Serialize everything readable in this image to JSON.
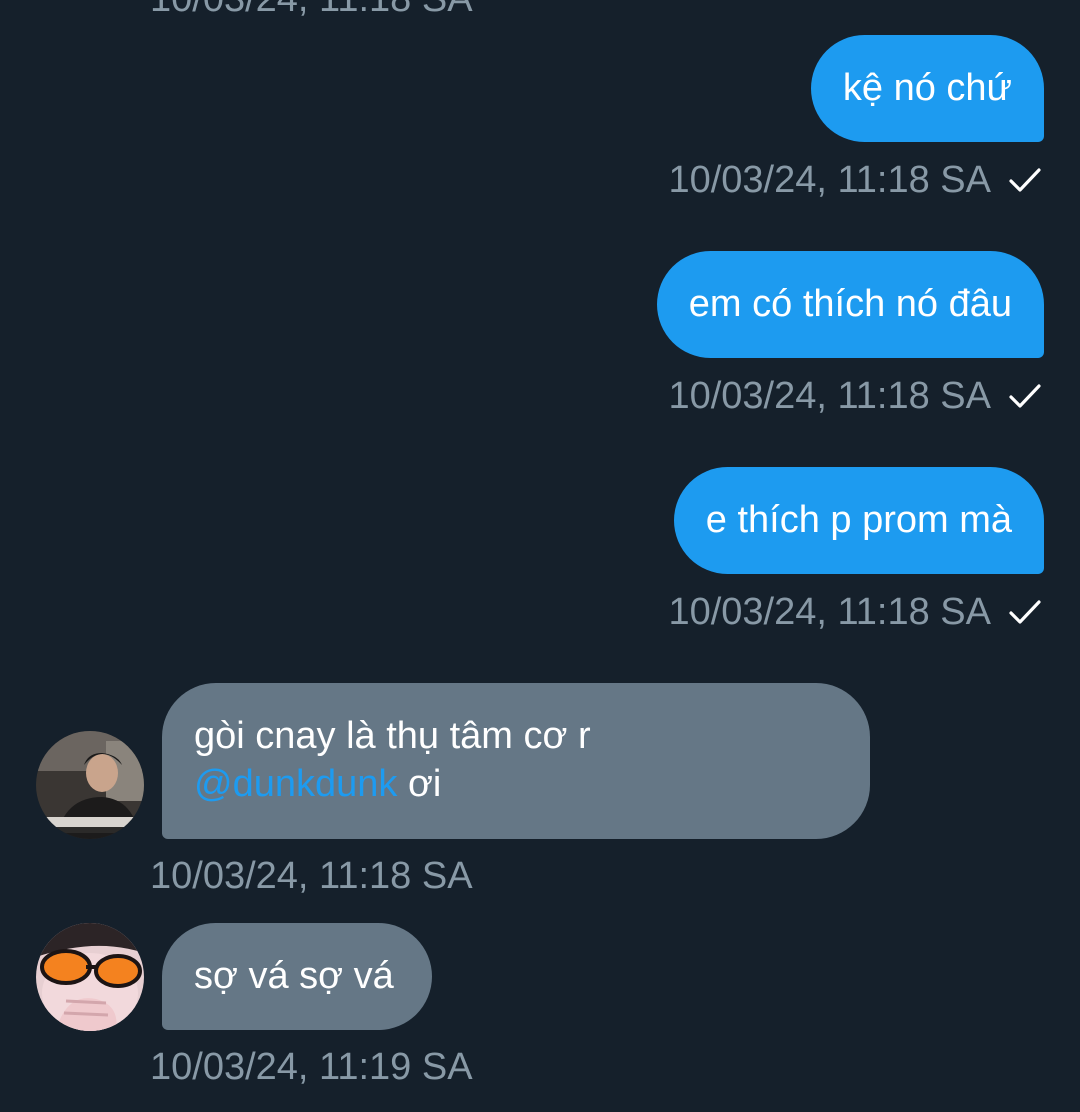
{
  "top_partial_timestamp": "10/03/24, 11:18 SA",
  "messages": [
    {
      "direction": "sent",
      "text": "kệ nó chứ",
      "timestamp": "10/03/24, 11:18 SA",
      "status": "check-icon"
    },
    {
      "direction": "sent",
      "text": "em có thích nó đâu",
      "timestamp": "10/03/24, 11:18 SA",
      "status": "check-icon"
    },
    {
      "direction": "sent",
      "text": "e thích p prom mà",
      "timestamp": "10/03/24, 11:18 SA",
      "status": "check-icon"
    },
    {
      "direction": "received",
      "text_line1": "gòi cnay là thụ tâm cơ r",
      "mention": "@dunkdunk",
      "text_after_mention": " ơi",
      "timestamp": "10/03/24, 11:18 SA",
      "avatar": "avatar-dark-photo"
    },
    {
      "direction": "received",
      "text": "sợ vá sợ vá",
      "timestamp": "10/03/24, 11:19 SA",
      "avatar": "avatar-orange-sunglasses"
    }
  ],
  "colors": {
    "background": "#15202b",
    "sent_bubble": "#1d9bf0",
    "received_bubble": "#657786",
    "timestamp": "#8899a6",
    "mention": "#1d9bf0"
  }
}
